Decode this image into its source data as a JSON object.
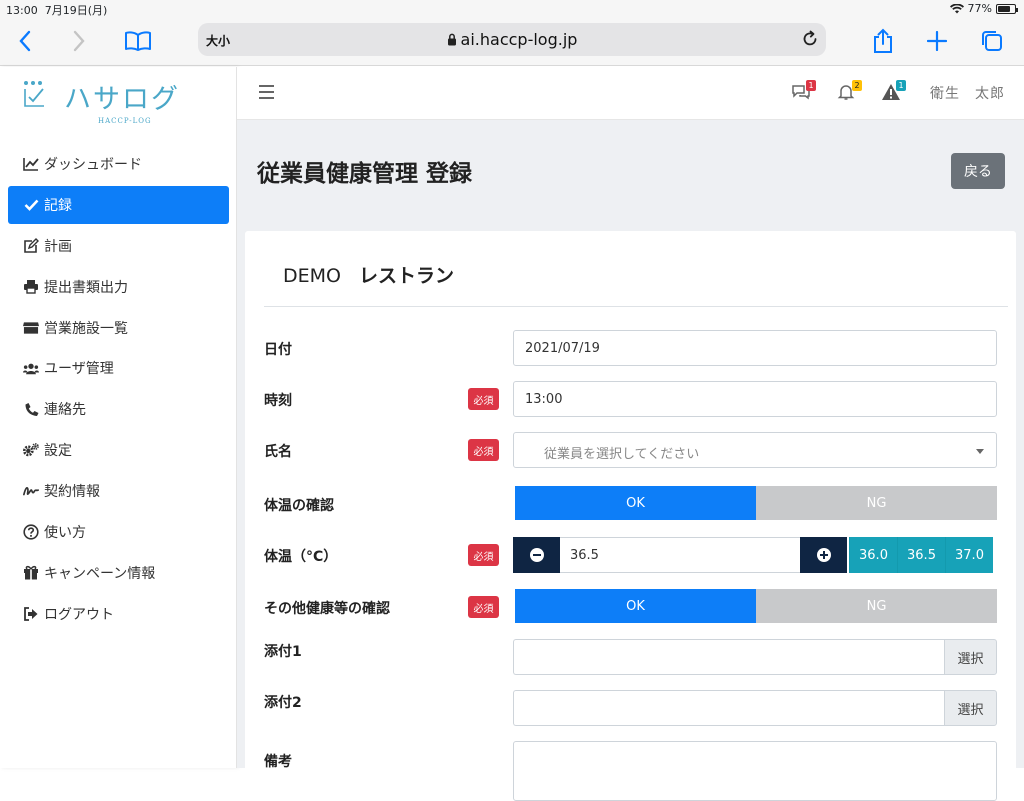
{
  "status": {
    "time": "13:00",
    "date": "7月19日(月)",
    "battery": "77%",
    "battery_level": 0.77
  },
  "browser": {
    "text_size": "大小",
    "url": "ai.haccp-log.jp"
  },
  "logo": {
    "name": "ハサログ",
    "sub": "HACCP-LOG"
  },
  "nav": [
    {
      "label": "ダッシュボード",
      "icon": "chart-icon"
    },
    {
      "label": "記録",
      "icon": "check-icon",
      "active": true
    },
    {
      "label": "計画",
      "icon": "edit-icon"
    },
    {
      "label": "提出書類出力",
      "icon": "print-icon"
    },
    {
      "label": "営業施設一覧",
      "icon": "store-icon"
    },
    {
      "label": "ユーザ管理",
      "icon": "users-icon"
    },
    {
      "label": "連絡先",
      "icon": "phone-icon"
    },
    {
      "label": "設定",
      "icon": "gears-icon"
    },
    {
      "label": "契約情報",
      "icon": "signature-icon"
    },
    {
      "label": "使い方",
      "icon": "question-icon"
    },
    {
      "label": "キャンペーン情報",
      "icon": "gift-icon"
    },
    {
      "label": "ログアウト",
      "icon": "logout-icon"
    }
  ],
  "topbar": {
    "messages_count": "1",
    "notifications_count": "2",
    "alerts_count": "1",
    "user_name": "衛生　太郎"
  },
  "page": {
    "title": "従業員健康管理 登録",
    "back_label": "戻る"
  },
  "card": {
    "company": "DEMO",
    "store": "レストラン"
  },
  "form": {
    "required_label": "必須",
    "date_label": "日付",
    "date_value": "2021/07/19",
    "time_label": "時刻",
    "time_value": "13:00",
    "name_label": "氏名",
    "name_placeholder": "従業員を選択してください",
    "temp_check_label": "体温の確認",
    "ok_label": "OK",
    "ng_label": "NG",
    "temp_label": "体温（°C）",
    "temp_value": "36.5",
    "temp_presets": [
      "36.0",
      "36.5",
      "37.0"
    ],
    "health_check_label": "その他健康等の確認",
    "attach1_label": "添付1",
    "attach2_label": "添付2",
    "select_label": "選択",
    "remarks_label": "備考"
  },
  "colors": {
    "primary": "#0d7ef8",
    "danger": "#dc3545",
    "info": "#17a2b8",
    "dark": "#0f2543"
  }
}
